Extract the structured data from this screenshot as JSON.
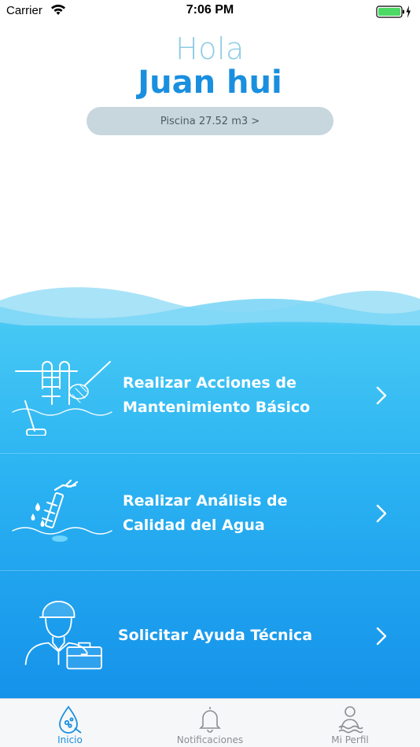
{
  "status_bar": {
    "carrier": "Carrier",
    "time": "7:06 PM"
  },
  "header": {
    "greeting": "Hola",
    "username": "Juan hui",
    "pool_button": "Piscina 27.52 m3 >"
  },
  "menu": {
    "items": [
      {
        "line1": "Realizar Acciones de",
        "line2": "Mantenimiento Básico",
        "icon": "pool-ladder-net-icon"
      },
      {
        "line1": "Realizar Análisis de",
        "line2": "Calidad del Agua",
        "icon": "water-test-icon"
      },
      {
        "line1": "Solicitar Ayuda Técnica",
        "icon": "technician-icon"
      }
    ]
  },
  "tabs": [
    {
      "label": "Inicio",
      "icon": "pool-home-icon",
      "active": true
    },
    {
      "label": "Notificaciones",
      "icon": "bell-icon",
      "active": false
    },
    {
      "label": "Mi Perfil",
      "icon": "swimmer-icon",
      "active": false
    }
  ],
  "colors": {
    "accent": "#1a8fdf",
    "greeting": "#8ccbe4",
    "pill": "#c8d6de",
    "water_top": "#46c8f4",
    "water_bottom": "#1592ea"
  }
}
